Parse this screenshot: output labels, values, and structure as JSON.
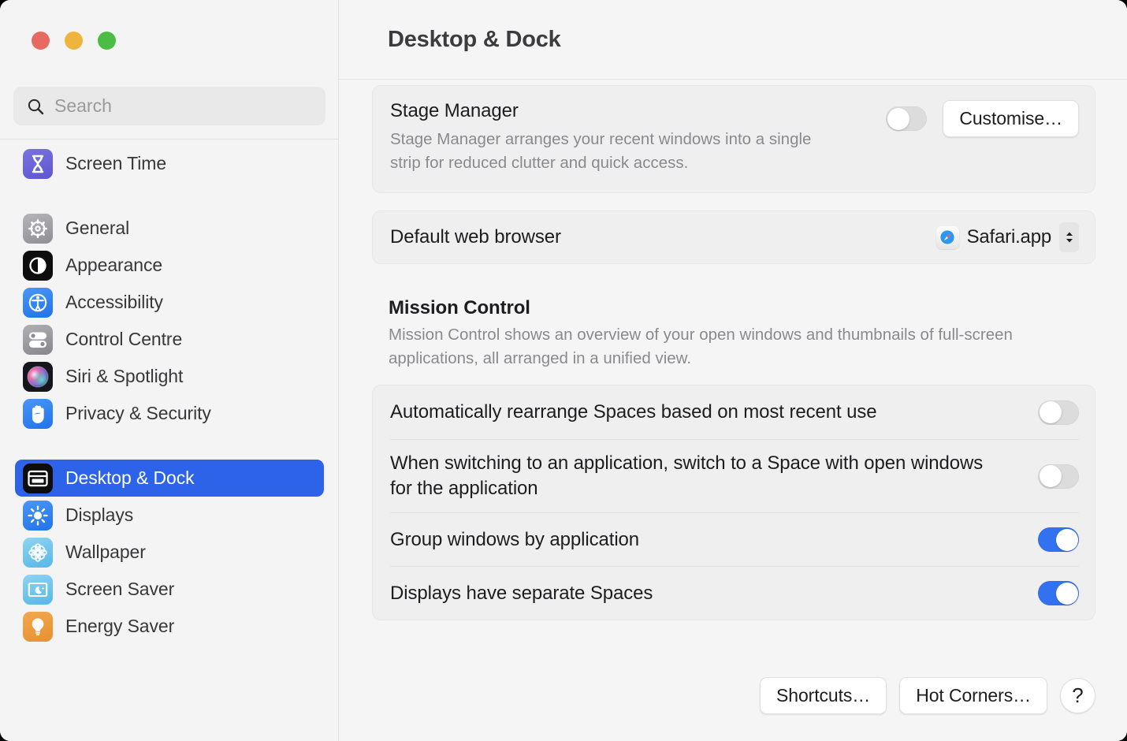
{
  "window": {
    "traffic_lights": [
      {
        "name": "close",
        "color": "#e8695f"
      },
      {
        "name": "minimise",
        "color": "#eeb43d"
      },
      {
        "name": "zoom",
        "color": "#4cbd44"
      }
    ]
  },
  "search": {
    "placeholder": "Search",
    "value": "",
    "icon": "search-icon"
  },
  "sidebar": {
    "items": [
      {
        "label": "Screen Time",
        "icon": "screen-time-icon",
        "selected": false,
        "gap_after": true
      },
      {
        "label": "General",
        "icon": "general-icon",
        "selected": false
      },
      {
        "label": "Appearance",
        "icon": "appearance-icon",
        "selected": false
      },
      {
        "label": "Accessibility",
        "icon": "accessibility-icon",
        "selected": false
      },
      {
        "label": "Control Centre",
        "icon": "control-centre-icon",
        "selected": false
      },
      {
        "label": "Siri & Spotlight",
        "icon": "siri-spotlight-icon",
        "selected": false
      },
      {
        "label": "Privacy & Security",
        "icon": "privacy-security-icon",
        "selected": false,
        "gap_after": true
      },
      {
        "label": "Desktop & Dock",
        "icon": "desktop-dock-icon",
        "selected": true
      },
      {
        "label": "Displays",
        "icon": "displays-icon",
        "selected": false
      },
      {
        "label": "Wallpaper",
        "icon": "wallpaper-icon",
        "selected": false
      },
      {
        "label": "Screen Saver",
        "icon": "screen-saver-icon",
        "selected": false
      },
      {
        "label": "Energy Saver",
        "icon": "energy-saver-icon",
        "selected": false
      }
    ],
    "selected_accent": "#2d63e8"
  },
  "header": {
    "title": "Desktop & Dock"
  },
  "stage_manager": {
    "title": "Stage Manager",
    "description": "Stage Manager arranges your recent windows into a single strip for reduced clutter and quick access.",
    "toggle_on": false,
    "customise_label": "Customise…"
  },
  "default_browser": {
    "label": "Default web browser",
    "value": "Safari.app",
    "icon": "safari-icon"
  },
  "mission_control": {
    "title": "Mission Control",
    "description": "Mission Control shows an overview of your open windows and thumbnails of full-screen applications, all arranged in a unified view.",
    "rows": [
      {
        "label": "Automatically rearrange Spaces based on most recent use",
        "toggle_on": false
      },
      {
        "label": "When switching to an application, switch to a Space with open windows for the application",
        "toggle_on": false
      },
      {
        "label": "Group windows by application",
        "toggle_on": true
      },
      {
        "label": "Displays have separate Spaces",
        "toggle_on": true
      }
    ]
  },
  "footer": {
    "shortcuts_label": "Shortcuts…",
    "hot_corners_label": "Hot Corners…",
    "help_label": "?"
  },
  "colors": {
    "accent_blue": "#3272f0",
    "toggle_off": "#dcdcdc",
    "window_bg": "#f5f5f5",
    "card_bg": "#efefef"
  }
}
